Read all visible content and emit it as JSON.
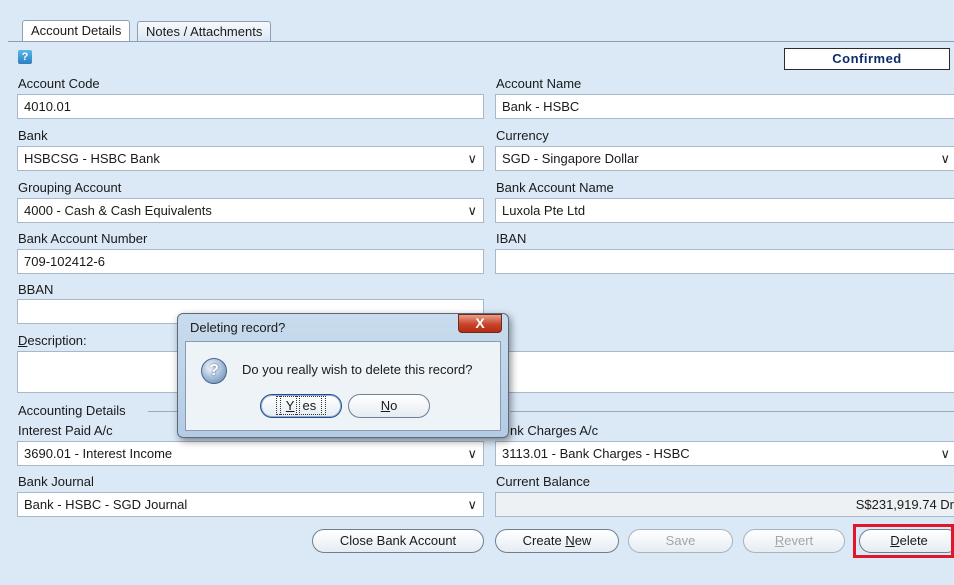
{
  "tabs": [
    {
      "label": "Account Details",
      "active": true
    },
    {
      "label": "Notes / Attachments",
      "active": false
    }
  ],
  "status": "Confirmed",
  "help_icon_text": "?",
  "form": {
    "account_code": {
      "label": "Account Code",
      "value": "4010.01"
    },
    "account_name": {
      "label": "Account Name",
      "value": "Bank - HSBC"
    },
    "bank": {
      "label": "Bank",
      "value": "HSBCSG - HSBC Bank"
    },
    "currency": {
      "label": "Currency",
      "value": "SGD - Singapore Dollar"
    },
    "grouping_account": {
      "label": "Grouping Account",
      "value": "4000 - Cash & Cash Equivalents"
    },
    "bank_account_name": {
      "label": "Bank Account Name",
      "value": "Luxola Pte Ltd"
    },
    "bank_account_number": {
      "label": "Bank Account Number",
      "value": "709-102412-6"
    },
    "iban": {
      "label": "IBAN",
      "value": ""
    },
    "bban": {
      "label": "BBAN",
      "value": ""
    },
    "description": {
      "label_prefix": "D",
      "label_rest": "escription:",
      "value": ""
    },
    "section_accounting": "Accounting Details",
    "interest_paid": {
      "label": "Interest Paid A/c",
      "value": "3690.01 - Interest Income"
    },
    "bank_charges": {
      "label": "nk Charges A/c",
      "value": "3113.01 - Bank Charges - HSBC"
    },
    "bank_journal": {
      "label": "Bank Journal",
      "value": "Bank - HSBC - SGD Journal"
    },
    "current_balance": {
      "label": "Current Balance",
      "value": "S$231,919.74 Dr"
    }
  },
  "buttons": {
    "close_bank_account": "Close Bank Account",
    "create_new_pre": "Create ",
    "create_new_ul": "N",
    "create_new_post": "ew",
    "save": "Save",
    "revert_ul": "R",
    "revert_post": "evert",
    "delete_ul": "D",
    "delete_post": "elete"
  },
  "dialog": {
    "title": "Deleting record?",
    "close": "X",
    "icon": "?",
    "message": "Do you really wish to delete this record?",
    "yes_ul": "Y",
    "yes_post": "es",
    "no_ul": "N",
    "no_post": "o"
  },
  "colors": {
    "background": "#dbe9f7",
    "highlight": "#e2162a",
    "status_text": "#0d2b6b"
  }
}
